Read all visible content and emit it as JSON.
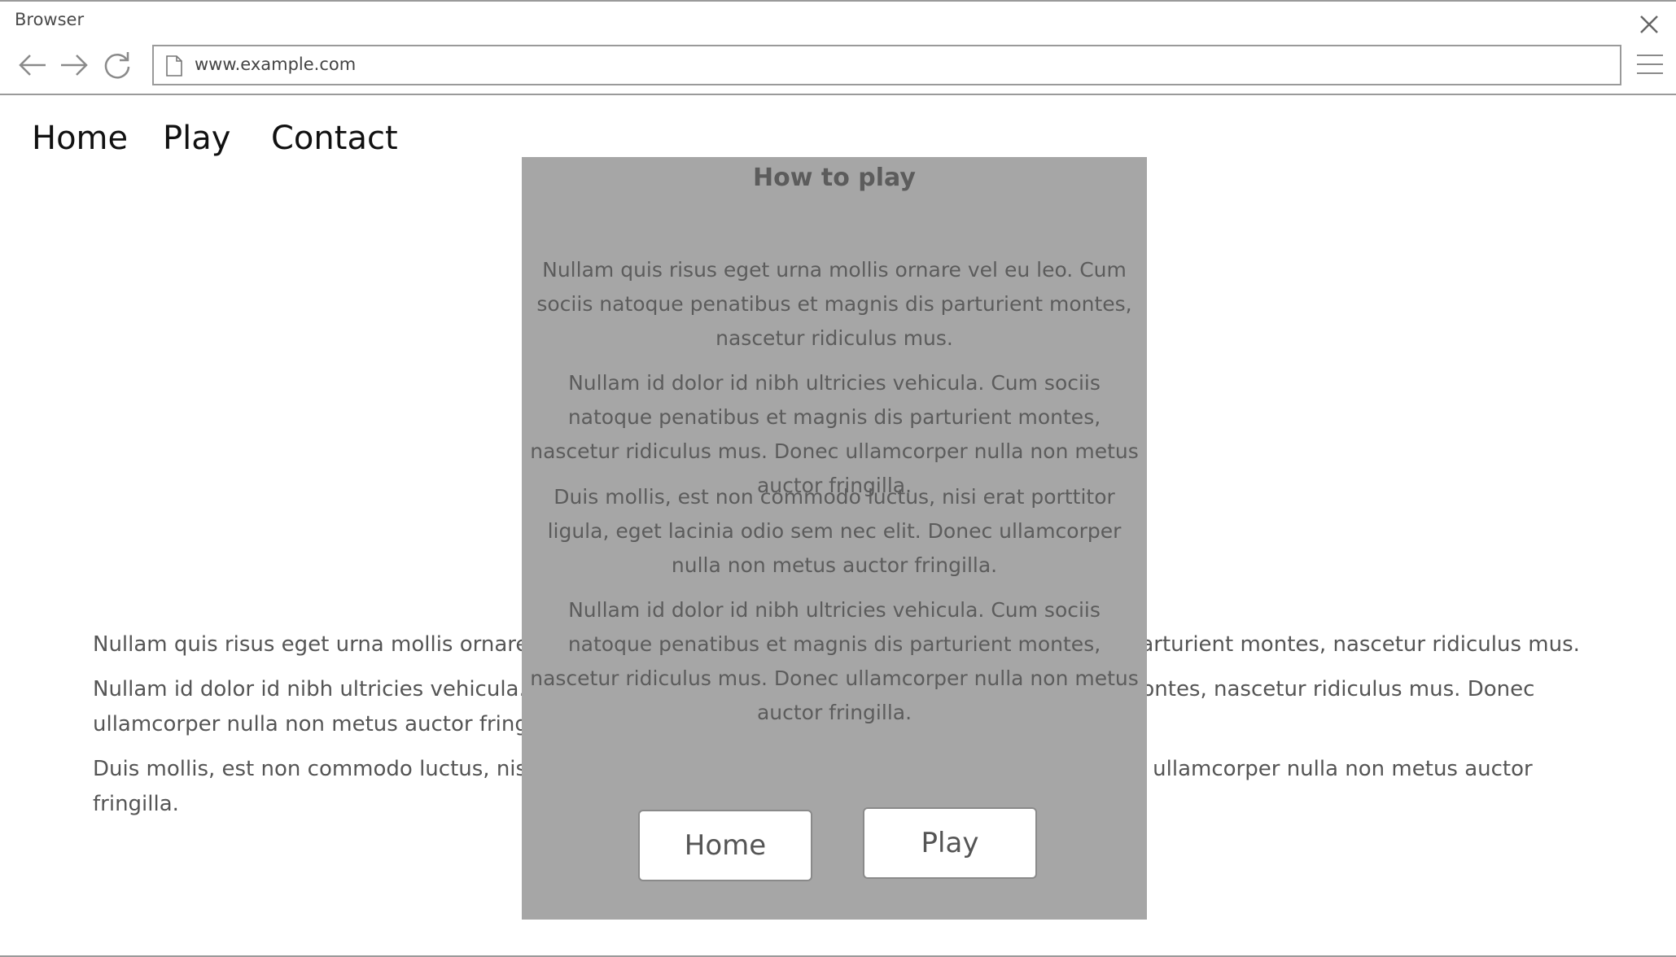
{
  "browser": {
    "window_title": "Browser",
    "url": "www.example.com"
  },
  "site_nav": {
    "items": [
      "Home",
      "Play",
      "Contact"
    ]
  },
  "page": {
    "paragraphs": [
      "Nullam quis risus eget urna mollis ornare vel eu leo. Cum sociis natoque penatibus et magnis dis parturient montes, nascetur ridiculus mus.",
      "Nullam id dolor id nibh ultricies vehicula. Cum sociis natoque penatibus et magnis dis parturient montes, nascetur ridiculus mus. Donec ullamcorper nulla non metus auctor fringilla.",
      "Duis mollis, est non commodo luctus, nisi erat porttitor ligula, eget lacinia odio sem nec elit. Donec ullamcorper nulla non metus auctor fringilla."
    ]
  },
  "modal": {
    "title": "How to play",
    "paragraphs": [
      "Nullam quis risus eget urna mollis ornare vel eu leo. Cum sociis natoque penatibus et magnis dis parturient montes, nascetur ridiculus mus.",
      "Nullam id dolor id nibh ultricies vehicula. Cum sociis natoque penatibus et magnis dis parturient montes, nascetur ridiculus mus. Donec ullamcorper nulla non metus auctor fringilla.",
      "Duis mollis, est non commodo luctus, nisi erat porttitor ligula, eget lacinia odio sem nec elit. Donec ullamcorper nulla non metus auctor fringilla.",
      "Nullam id dolor id nibh ultricies vehicula. Cum sociis natoque penatibus et magnis dis parturient montes, nascetur ridiculus mus. Donec ullamcorper nulla non metus auctor fringilla."
    ],
    "home_button": "Home",
    "play_button": "Play"
  },
  "icons": {
    "close": "close-icon",
    "back": "back-arrow-icon",
    "forward": "forward-arrow-icon",
    "reload": "reload-icon",
    "page": "page-icon",
    "menu": "hamburger-menu-icon"
  },
  "colors": {
    "modal_background": "#a6a6a6",
    "modal_text": "#5c5c5c",
    "border": "#9a9a9a"
  }
}
